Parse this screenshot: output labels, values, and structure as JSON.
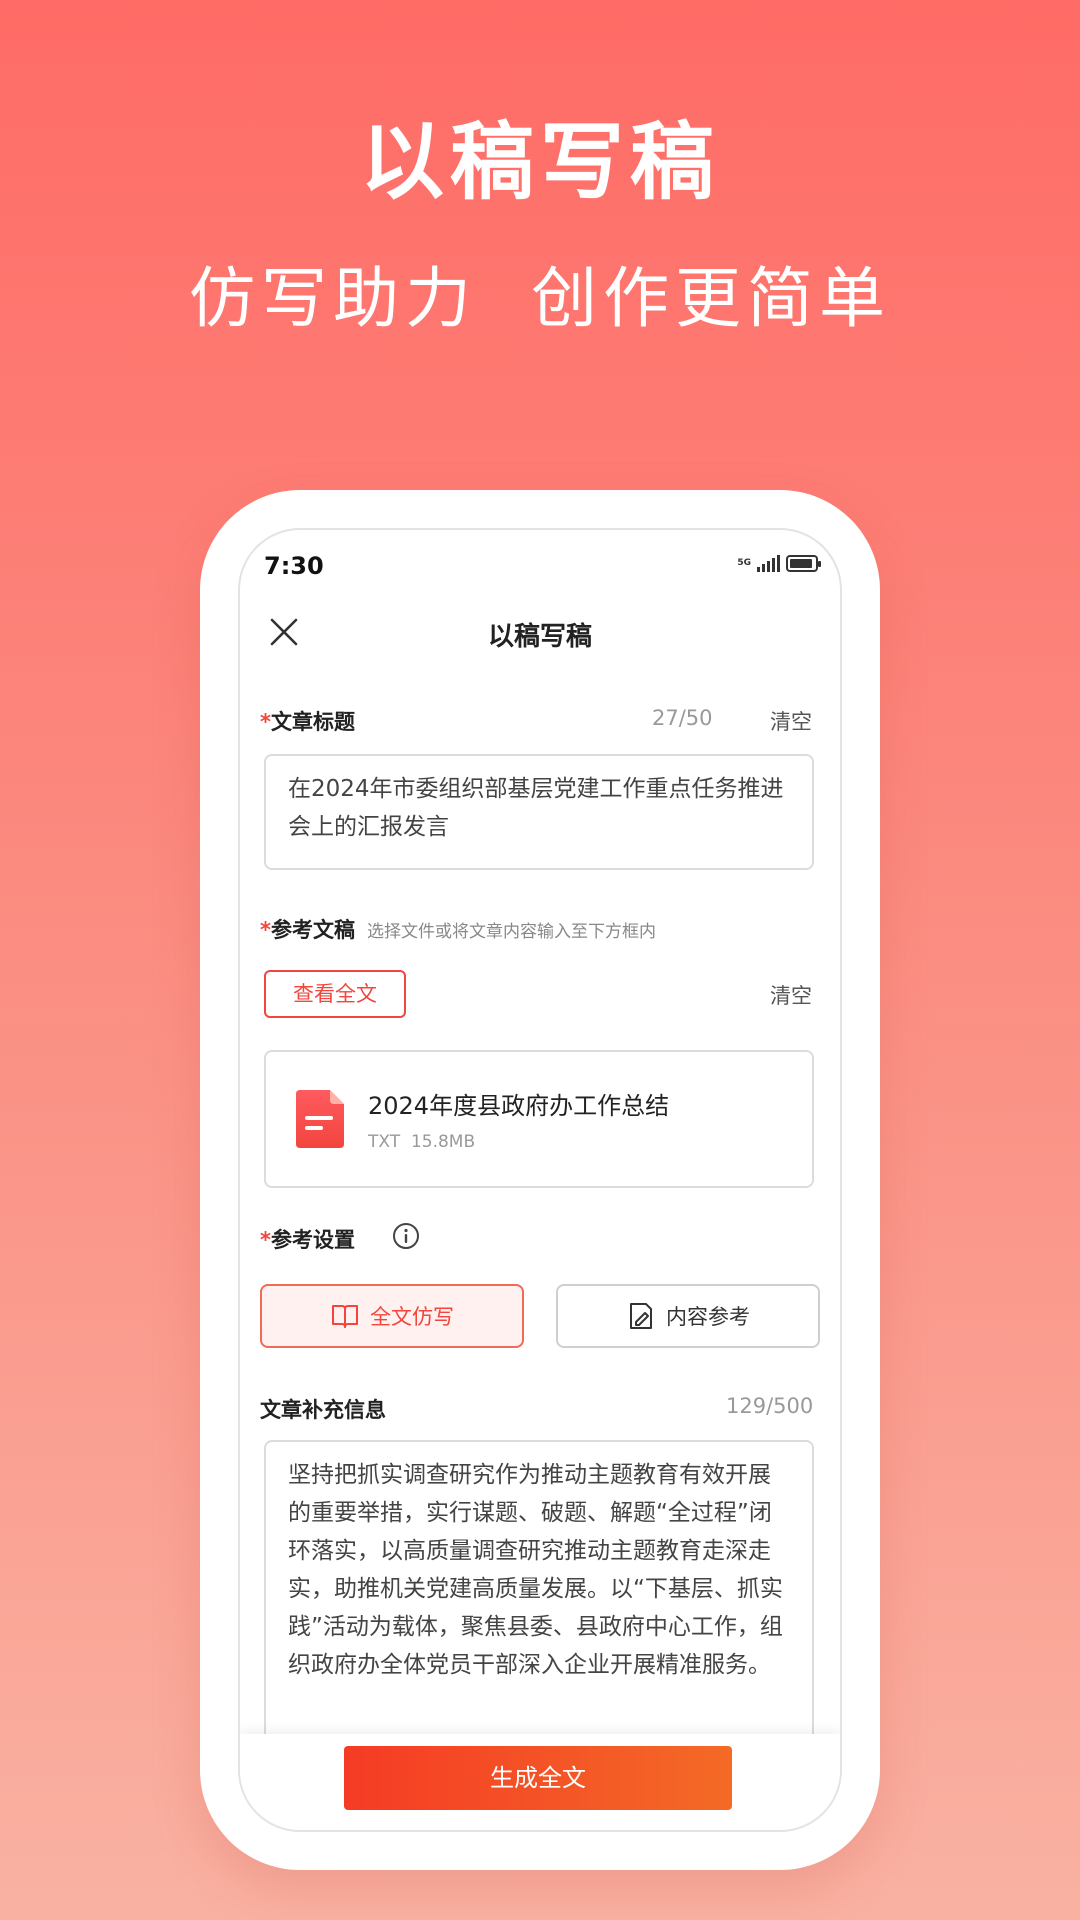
{
  "hero": {
    "title": "以稿写稿",
    "subtitle": "仿写助力  创作更简单"
  },
  "status": {
    "time": "7:30",
    "network": "5G"
  },
  "nav": {
    "title": "以稿写稿",
    "close_icon": "close-icon"
  },
  "article_title": {
    "required_mark": "*",
    "label": "文章标题",
    "count": "27/50",
    "clear": "清空",
    "value": "在2024年市委组织部基层党建工作重点任务推进会上的汇报发言"
  },
  "reference": {
    "required_mark": "*",
    "label": "参考文稿",
    "hint": "选择文件或将文章内容输入至下方框内",
    "view_full": "查看全文",
    "clear": "清空",
    "file": {
      "name": "2024年度县政府办工作总结",
      "type": "TXT",
      "size": "15.8MB",
      "icon": "document-icon"
    }
  },
  "settings": {
    "required_mark": "*",
    "label": "参考设置",
    "info_icon": "info-icon",
    "options": [
      {
        "label": "全文仿写",
        "icon": "book-icon",
        "selected": true
      },
      {
        "label": "内容参考",
        "icon": "edit-doc-icon",
        "selected": false
      }
    ]
  },
  "supplement": {
    "label": "文章补充信息",
    "count": "129/500",
    "value": "坚持把抓实调查研究作为推动主题教育有效开展的重要举措，实行谋题、破题、解题“全过程”闭环落实，以高质量调查研究推动主题教育走深走实，助推机关党建高质量发展。以“下基层、抓实践”活动为载体，聚焦县委、县政府中心工作，组织政府办全体党员干部深入企业开展精准服务。"
  },
  "actions": {
    "generate": "生成全文"
  },
  "colors": {
    "accent": "#f2453d",
    "background_top": "#ff6b66",
    "background_bottom": "#f9b2a2"
  }
}
